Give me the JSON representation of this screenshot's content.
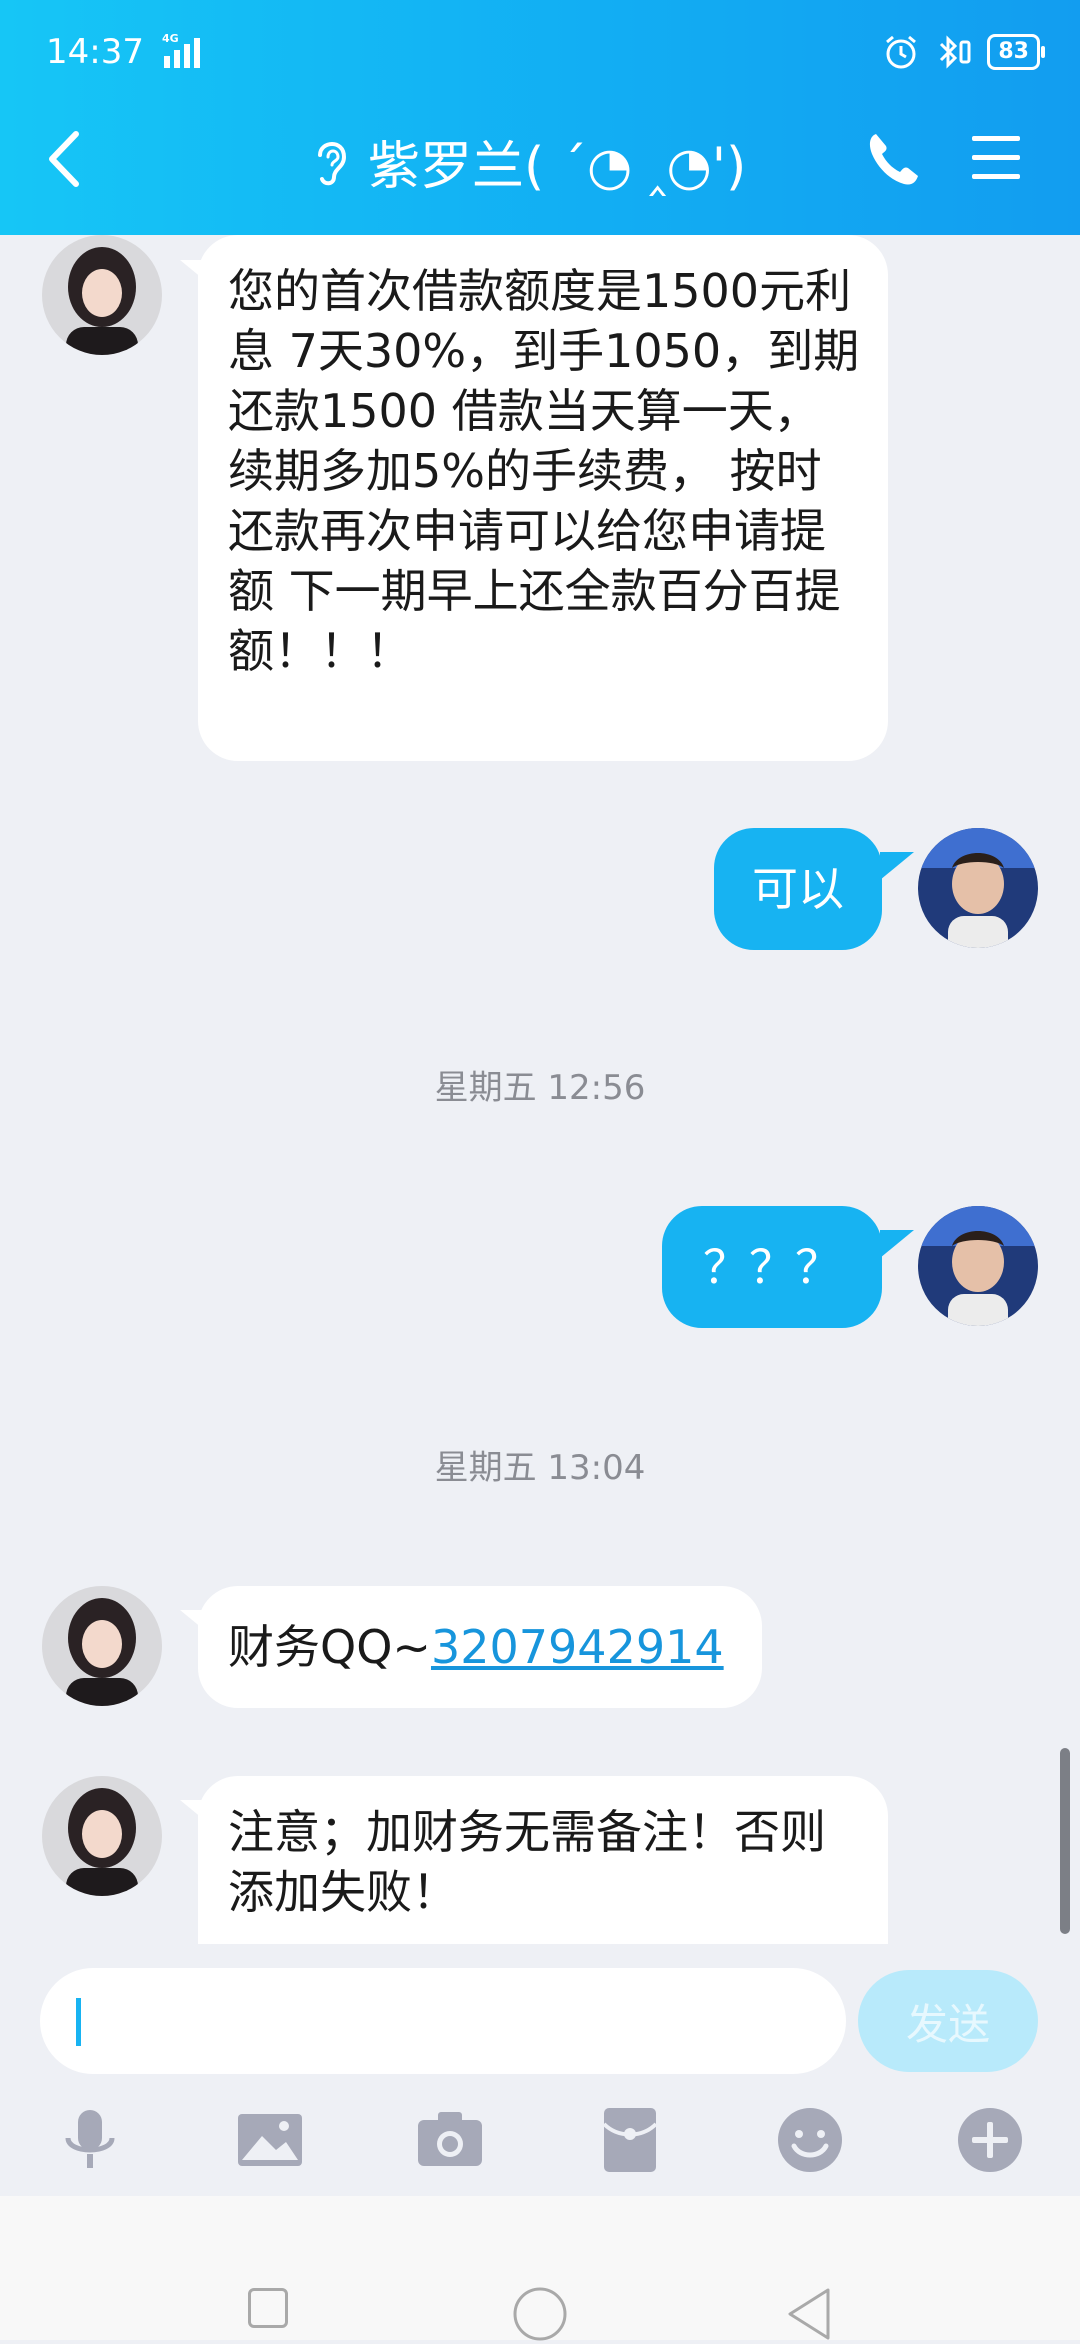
{
  "status_bar": {
    "time": "14:37",
    "network": "4G",
    "battery": "83"
  },
  "header": {
    "title": "紫罗兰( ´◔ ‸◔')"
  },
  "colors": {
    "header": "#129df0",
    "outgoing_bubble": "#17b3f2",
    "background": "#eef0f5",
    "link": "#1795dc"
  },
  "messages": [
    {
      "direction": "incoming",
      "text": "您的首次借款额度是1500元利息 7天30%，到手1050，到期还款1500 借款当天算一天，续期多加5%的手续费， 按时还款再次申请可以给您申请提额  下一期早上还全款百分百提额！！！"
    },
    {
      "direction": "outgoing",
      "text": "可以"
    },
    {
      "type": "timestamp",
      "text": "星期五 12:56"
    },
    {
      "direction": "outgoing",
      "text": "？？？"
    },
    {
      "type": "timestamp",
      "text": "星期五 13:04"
    },
    {
      "direction": "incoming",
      "prefix": "财务QQ~",
      "link": "3207942914"
    },
    {
      "direction": "incoming",
      "text": "注意；加财务无需备注！否则添加失败！"
    }
  ],
  "input": {
    "value": "",
    "send_label": "发送"
  },
  "toolbar": [
    "microphone-icon",
    "image-icon",
    "camera-icon",
    "red-envelope-icon",
    "emoji-icon",
    "plus-icon"
  ]
}
